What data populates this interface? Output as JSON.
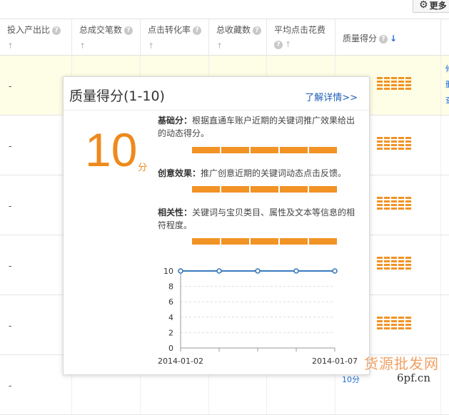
{
  "toolbar": {
    "more_label": "更多",
    "more_icon": "gear-icon"
  },
  "table": {
    "headers": [
      {
        "label": "投入产出比",
        "help": true
      },
      {
        "label": "总成交笔数",
        "help": true
      },
      {
        "label": "点击转化率",
        "help": true
      },
      {
        "label": "总收藏数",
        "help": true
      },
      {
        "label": "平均点击花费",
        "help": true
      },
      {
        "label": "质量得分",
        "help": true,
        "sort": "↓"
      }
    ],
    "rows": [
      {
        "value": "-",
        "highlight": true
      },
      {
        "value": "-"
      },
      {
        "value": "-"
      },
      {
        "value": "-"
      },
      {
        "value": "-"
      },
      {
        "value": "-"
      }
    ],
    "partial_score": "10分"
  },
  "popover": {
    "title": "质量得分(1-10)",
    "link": "了解详情>>",
    "score": "10",
    "unit": "分",
    "items": [
      {
        "label": "基础分：",
        "desc": "根据直通车账户近期的关键词推广效果给出的动态得分。"
      },
      {
        "label": "创意效果：",
        "desc": "推广创意近期的关键词动态点击反馈。"
      },
      {
        "label": "相关性：",
        "desc": "关键词与宝贝类目、属性及文本等信息的相符程度。"
      }
    ],
    "accent": "#f19325"
  },
  "chart_data": {
    "type": "line",
    "x": [
      "2014-01-02",
      "2014-01-03",
      "2014-01-04",
      "2014-01-05",
      "2014-01-07"
    ],
    "x_tick_labels": [
      "2014-01-02",
      "2014-01-07"
    ],
    "series": [
      {
        "values": [
          10,
          10,
          10,
          10,
          10
        ]
      }
    ],
    "yticks": [
      0,
      2,
      4,
      6,
      8,
      10
    ],
    "ylim": [
      0,
      10
    ],
    "line_color": "#3a7bbf"
  },
  "watermark": {
    "cn": "货源批发网",
    "en": "6pf.cn"
  }
}
